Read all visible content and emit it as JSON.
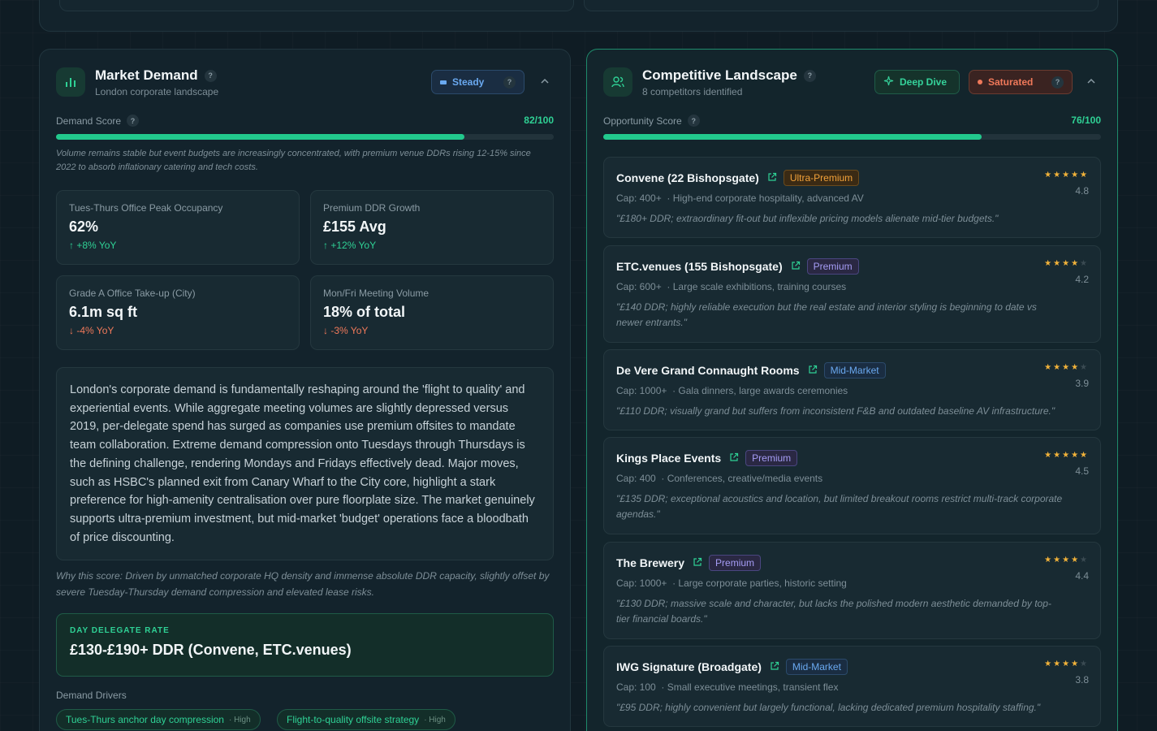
{
  "market": {
    "title": "Market Demand",
    "subtitle": "London corporate landscape",
    "status_label": "Steady",
    "score_label": "Demand Score",
    "score_text": "82/100",
    "score_fraction": 0.82,
    "score_note": "Volume remains stable but event budgets are increasingly concentrated, with premium venue DDRs rising 12-15% since 2022 to absorb inflationary catering and tech costs.",
    "metrics": [
      {
        "label": "Tues-Thurs Office Peak Occupancy",
        "value": "62%",
        "change": "+8% YoY",
        "direction": "up"
      },
      {
        "label": "Premium DDR Growth",
        "value": "£155 Avg",
        "change": "+12% YoY",
        "direction": "up"
      },
      {
        "label": "Grade A Office Take-up (City)",
        "value": "6.1m sq ft",
        "change": "-4% YoY",
        "direction": "down"
      },
      {
        "label": "Mon/Fri Meeting Volume",
        "value": "18% of total",
        "change": "-3% YoY",
        "direction": "down"
      }
    ],
    "analysis": "London's corporate demand is fundamentally reshaping around the 'flight to quality' and experiential events. While aggregate meeting volumes are slightly depressed versus 2019, per-delegate spend has surged as companies use premium offsites to mandate team collaboration. Extreme demand compression onto Tuesdays through Thursdays is the defining challenge, rendering Mondays and Fridays effectively dead. Major moves, such as HSBC's planned exit from Canary Wharf to the City core, highlight a stark preference for high-amenity centralisation over pure floorplate size. The market genuinely supports ultra-premium investment, but mid-market 'budget' operations face a bloodbath of price discounting.",
    "why": "Why this score: Driven by unmatched corporate HQ density and immense absolute DDR capacity, slightly offset by severe Tuesday-Thursday demand compression and elevated lease risks.",
    "rate_label": "DAY DELEGATE RATE",
    "rate_value": "£130-£190+ DDR (Convene, ETC.venues)",
    "drivers_label": "Demand Drivers",
    "drivers": [
      {
        "label": "Tues-Thurs anchor day compression",
        "level": "· High"
      },
      {
        "label": "Flight-to-quality offsite strategy",
        "level": "· High"
      }
    ]
  },
  "competitive": {
    "title": "Competitive Landscape",
    "subtitle": "8 competitors identified",
    "deep_dive_label": "Deep Dive",
    "status_label": "Saturated",
    "score_label": "Opportunity Score",
    "score_text": "76/100",
    "score_fraction": 0.76,
    "competitors": [
      {
        "name": "Convene (22 Bishopsgate)",
        "tier": "Ultra-Premium",
        "tier_class": "ultra",
        "stars": 5,
        "rating": "4.8",
        "cap": "Cap: 400+",
        "desc": "· High-end corporate hospitality, advanced AV",
        "quote": "\"£180+ DDR; extraordinary fit-out but inflexible pricing models alienate mid-tier budgets.\""
      },
      {
        "name": "ETC.venues (155 Bishopsgate)",
        "tier": "Premium",
        "tier_class": "prem",
        "stars": 4,
        "rating": "4.2",
        "cap": "Cap: 600+",
        "desc": "· Large scale exhibitions, training courses",
        "quote": "\"£140 DDR; highly reliable execution but the real estate and interior styling is beginning to date vs newer entrants.\""
      },
      {
        "name": "De Vere Grand Connaught Rooms",
        "tier": "Mid-Market",
        "tier_class": "mid",
        "stars": 4,
        "rating": "3.9",
        "cap": "Cap: 1000+",
        "desc": "· Gala dinners, large awards ceremonies",
        "quote": "\"£110 DDR; visually grand but suffers from inconsistent F&B and outdated baseline AV infrastructure.\""
      },
      {
        "name": "Kings Place Events",
        "tier": "Premium",
        "tier_class": "prem",
        "stars": 5,
        "rating": "4.5",
        "cap": "Cap: 400",
        "desc": "· Conferences, creative/media events",
        "quote": "\"£135 DDR; exceptional acoustics and location, but limited breakout rooms restrict multi-track corporate agendas.\""
      },
      {
        "name": "The Brewery",
        "tier": "Premium",
        "tier_class": "prem",
        "stars": 4,
        "rating": "4.4",
        "cap": "Cap: 1000+",
        "desc": "· Large corporate parties, historic setting",
        "quote": "\"£130 DDR; massive scale and character, but lacks the polished modern aesthetic demanded by top-tier financial boards.\""
      },
      {
        "name": "IWG Signature (Broadgate)",
        "tier": "Mid-Market",
        "tier_class": "mid",
        "stars": 4,
        "rating": "3.8",
        "cap": "Cap: 100",
        "desc": "· Small executive meetings, transient flex",
        "quote": "\"£95 DDR; highly convenient but largely functional, lacking dedicated premium hospitality staffing.\""
      }
    ]
  },
  "colors": {
    "accent": "#22c98d",
    "up": "#2fd195",
    "down": "#f0795a",
    "star": "#f2b33a"
  },
  "icons": {
    "market": "bar-chart-icon",
    "competitive": "users-icon",
    "deep_dive": "sparkle-icon",
    "external": "external-link-icon"
  }
}
